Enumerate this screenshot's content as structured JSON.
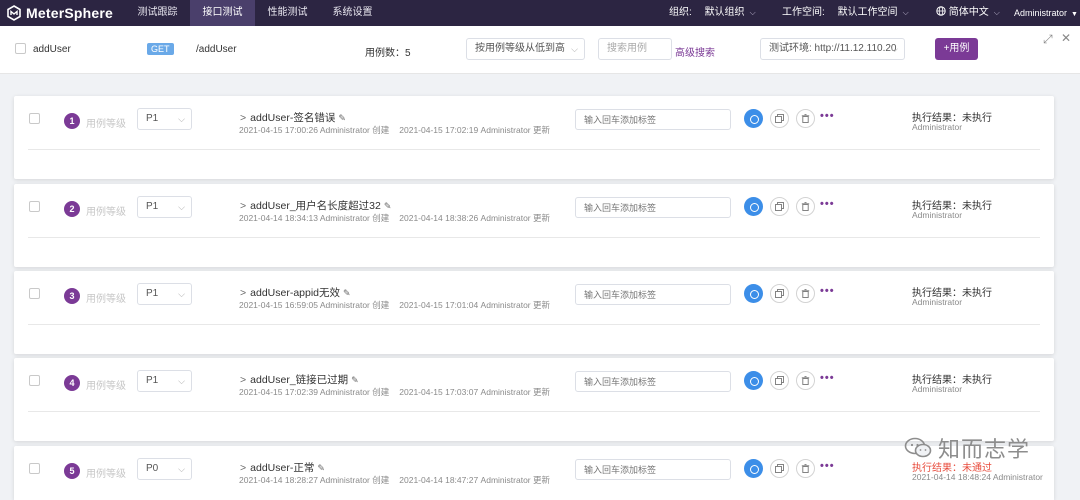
{
  "app": {
    "name": "MeterSphere"
  },
  "nav": {
    "tabs": [
      {
        "label": "测试跟踪",
        "active": false
      },
      {
        "label": "接口测试",
        "active": true
      },
      {
        "label": "性能测试",
        "active": false
      },
      {
        "label": "系统设置",
        "active": false
      }
    ],
    "org_label": "组织:",
    "org_value": "默认组织",
    "workspace_label": "工作空间:",
    "workspace_value": "默认工作空间",
    "language": "简体中文",
    "user": "Administrator"
  },
  "header": {
    "api_name": "addUser",
    "method": "GET",
    "path": "/addUser",
    "case_count_label": "用例数：5",
    "sort_select": "按用例等级从低到高",
    "search_placeholder": "搜索用例",
    "advanced_search": "高级搜索",
    "env_select": "测试环境: http://11.12.110.20",
    "add_case_button": "+用例"
  },
  "common": {
    "level_label": "用例等级",
    "tag_placeholder": "输入回车添加标签",
    "result_label_pending": "执行结果：未执行",
    "result_label_fail": "执行结果：未通过",
    "created_suffix": "Administrator 创建",
    "updated_suffix": "Administrator 更新"
  },
  "colors": {
    "nav_bg": "#2c2542",
    "brand": "#7b3a96",
    "primary": "#3c8ee8",
    "fail": "#e84c3d"
  },
  "cases": [
    {
      "index": "1",
      "priority": "P1",
      "name": "addUser-签名错误",
      "created": "2021-04-15 17:00:26 Administrator 创建",
      "updated": "2021-04-15 17:02:19 Administrator 更新",
      "result": "执行结果：未执行",
      "result_user": "Administrator",
      "status": "pending"
    },
    {
      "index": "2",
      "priority": "P1",
      "name": "addUser_用户名长度超过32",
      "created": "2021-04-14 18:34:13 Administrator 创建",
      "updated": "2021-04-14 18:38:26 Administrator 更新",
      "result": "执行结果：未执行",
      "result_user": "Administrator",
      "status": "pending"
    },
    {
      "index": "3",
      "priority": "P1",
      "name": "addUser-appid无效",
      "created": "2021-04-15 16:59:05 Administrator 创建",
      "updated": "2021-04-15 17:01:04 Administrator 更新",
      "result": "执行结果：未执行",
      "result_user": "Administrator",
      "status": "pending"
    },
    {
      "index": "4",
      "priority": "P1",
      "name": "addUser_链接已过期",
      "created": "2021-04-15 17:02:39 Administrator 创建",
      "updated": "2021-04-15 17:03:07 Administrator 更新",
      "result": "执行结果：未执行",
      "result_user": "Administrator",
      "status": "pending"
    },
    {
      "index": "5",
      "priority": "P0",
      "name": "addUser-正常",
      "created": "2021-04-14 18:28:27 Administrator 创建",
      "updated": "2021-04-14 18:47:27 Administrator 更新",
      "result": "执行结果：未通过",
      "result_user": "2021-04-14 18:48:24 Administrator",
      "status": "fail"
    }
  ],
  "watermark": {
    "text": "知而志学"
  }
}
